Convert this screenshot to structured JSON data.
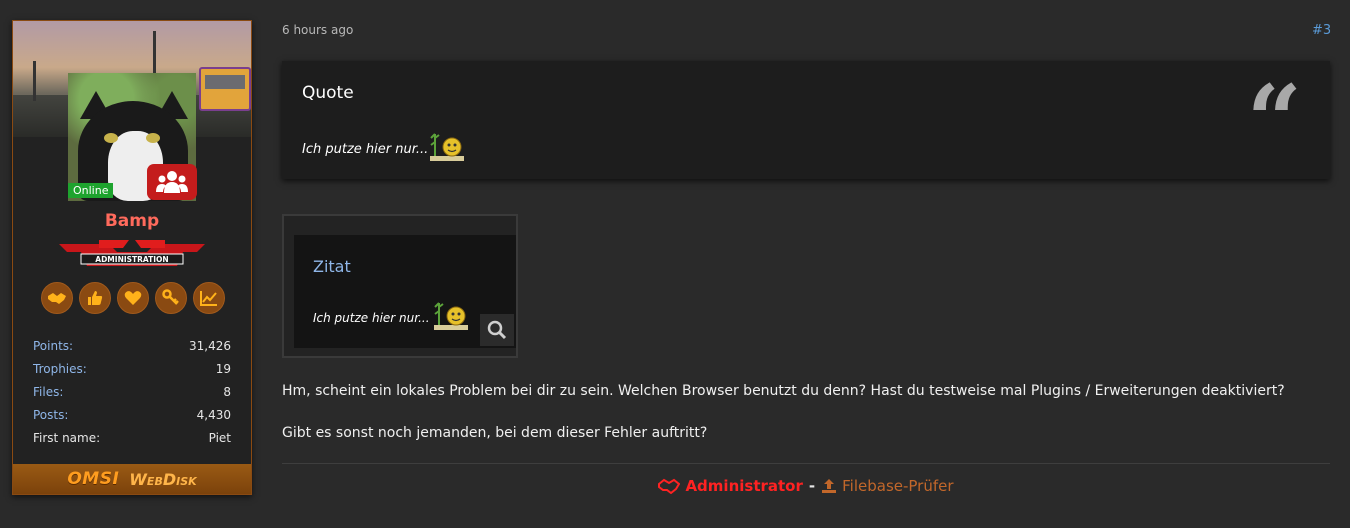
{
  "post": {
    "time": "6 hours ago",
    "number": "#3"
  },
  "sidebar": {
    "status": "Online",
    "username": "Bamp",
    "rank_banner": "ADMINISTRATION",
    "trophies": [
      "handshake-icon",
      "thumbs-up-icon",
      "heart-icon",
      "key-icon",
      "chart-line-icon"
    ],
    "stats": [
      {
        "label": "Points:",
        "value": "31,426"
      },
      {
        "label": "Trophies:",
        "value": "19"
      },
      {
        "label": "Files:",
        "value": "8"
      },
      {
        "label": "Posts:",
        "value": "4,430"
      },
      {
        "label": "First name:",
        "value": "Piet"
      }
    ],
    "webdisk": {
      "omsi": "OMSI",
      "webdisk": "WebDisk"
    }
  },
  "quote": {
    "title": "Quote",
    "text": "Ich putze hier nur..."
  },
  "attachment": {
    "title": "Zitat",
    "text": "Ich putze hier nur..."
  },
  "body": {
    "p1": "Hm, scheint ein lokales Problem bei dir zu sein. Welchen Browser benutzt du denn? Hast du testweise mal Plugins / Erweiterungen deaktiviert?",
    "p2": "Gibt es sonst noch jemanden, bei dem dieser Fehler auftritt?"
  },
  "roles": {
    "admin": "Administrator",
    "separator": "-",
    "filebase": "Filebase-Prüfer"
  },
  "colors": {
    "accent": "#8a4a12",
    "username": "#ff6a5c",
    "link": "#8fb6e8",
    "online": "#1ea32e",
    "admin": "#ff2222"
  }
}
